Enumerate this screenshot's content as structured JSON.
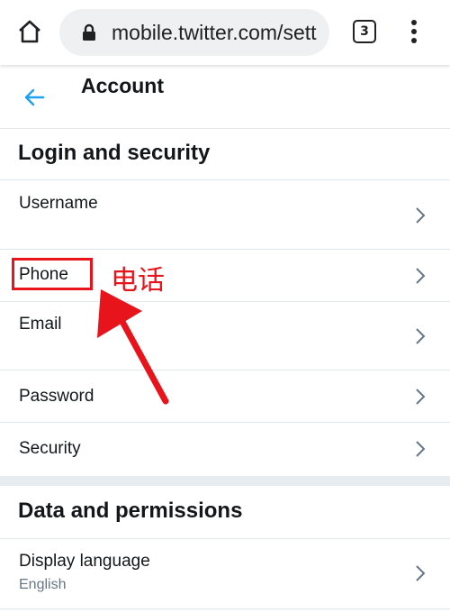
{
  "browser": {
    "url": "mobile.twitter.com/sett",
    "tab_count": "3"
  },
  "header": {
    "title": "Account"
  },
  "sections": [
    {
      "heading": "Login and security",
      "items": [
        {
          "label": "Username"
        },
        {
          "label": "Phone"
        },
        {
          "label": "Email"
        },
        {
          "label": "Password"
        },
        {
          "label": "Security"
        }
      ]
    },
    {
      "heading": "Data and permissions",
      "items": [
        {
          "label": "Display language",
          "sublabel": "English"
        }
      ]
    }
  ],
  "annotation": {
    "text": "电话",
    "color": "#e8141b"
  },
  "colors": {
    "accent": "#1da1f2",
    "divider": "#e1e8ed",
    "section_gap": "#e6ecf0",
    "chevron": "#657786"
  }
}
